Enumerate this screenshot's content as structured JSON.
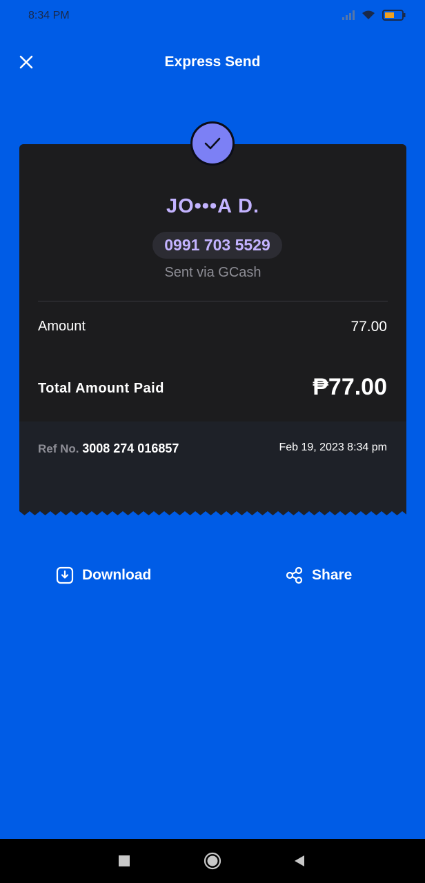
{
  "status_bar": {
    "time": "8:34 PM",
    "icons": [
      "signal-icon",
      "wifi-icon",
      "battery-icon"
    ]
  },
  "header": {
    "title": "Express Send",
    "close_icon": "close-icon"
  },
  "receipt": {
    "status_icon": "check-icon",
    "recipient_name": "JO•••A D.",
    "phone_number": "0991 703 5529",
    "sent_via": "Sent via GCash",
    "amount_label": "Amount",
    "amount_value": "77.00",
    "total_label": "Total Amount Paid",
    "total_value": "₱77.00",
    "ref_label": "Ref No.",
    "ref_number": "3008 274 016857",
    "date": "Feb 19, 2023 8:34 pm"
  },
  "actions": {
    "download_label": "Download",
    "download_icon": "download-icon",
    "share_label": "Share",
    "share_icon": "share-icon"
  },
  "nav_bar": {
    "icons": [
      "recents-icon",
      "home-icon",
      "back-icon"
    ]
  },
  "colors": {
    "background": "#005ce6",
    "card": "#1c1c1e",
    "card_lower": "#1e2128",
    "accent_purple": "#c3b3ff",
    "check_badge": "#7c80f5"
  }
}
